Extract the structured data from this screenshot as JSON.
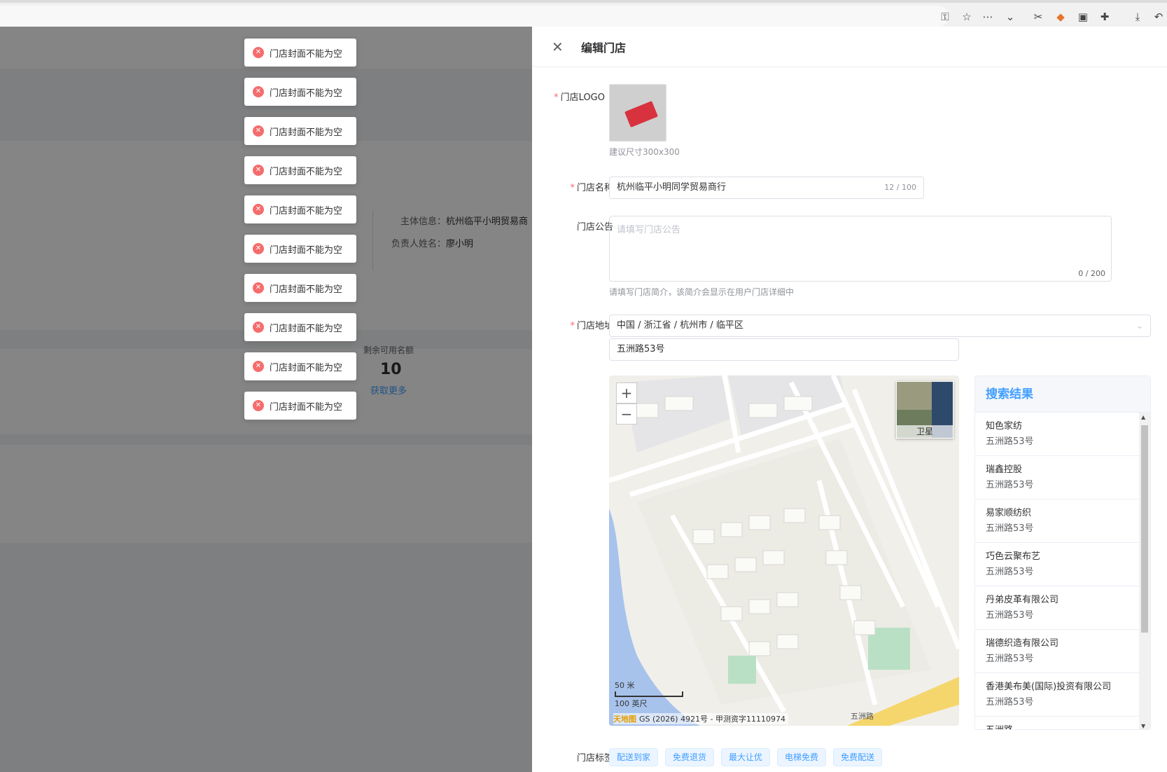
{
  "browser": {
    "icons": [
      "key-icon",
      "star-icon",
      "more-icon",
      "chevron-down-icon",
      "scissors-icon",
      "fox-extension-icon",
      "window-icon",
      "puzzle-icon",
      "download-icon",
      "undo-icon"
    ]
  },
  "background": {
    "subject_label": "主体信息：",
    "subject_value": "杭州临平小明贸易商",
    "owner_label": "负责人姓名：",
    "owner_value": "廖小明",
    "quota_label": "剩余可用名额",
    "quota_value": "10",
    "quota_link": "获取更多"
  },
  "toasts": [
    "门店封面不能为空",
    "门店封面不能为空",
    "门店封面不能为空",
    "门店封面不能为空",
    "门店封面不能为空",
    "门店封面不能为空",
    "门店封面不能为空",
    "门店封面不能为空",
    "门店封面不能为空",
    "门店封面不能为空"
  ],
  "drawer": {
    "close": "✕",
    "title": "编辑门店",
    "logo_label": "门店LOGO",
    "logo_hint": "建议尺寸300x300",
    "name_label": "门店名称",
    "name_value": "杭州临平小明同学贸易商行",
    "name_count": "12 / 100",
    "notice_label": "门店公告",
    "notice_placeholder": "请填写门店公告",
    "notice_count": "0 / 200",
    "notice_hint": "请填写门店简介，该简介会显示在用户门店详细中",
    "address_label": "门店地址",
    "region_value": "中国 / 浙江省 / 杭州市 / 临平区",
    "street_value": "五洲路53号",
    "tags_label": "门店标签",
    "tags": [
      "配送到家",
      "免费退货",
      "最大让优",
      "电梯免费",
      "免费配送"
    ]
  },
  "map": {
    "zoom_in": "+",
    "zoom_out": "−",
    "satellite_label": "卫星",
    "scale_m": "50 米",
    "scale_ft": "100 英尺",
    "brand": "天地图",
    "copyright": "GS (2026) 4921号 - 甲测资字11110974",
    "road_label": "五洲路"
  },
  "results": {
    "title": "搜索结果",
    "items": [
      {
        "name": "知色家纺",
        "addr": "五洲路53号"
      },
      {
        "name": "瑞鑫控股",
        "addr": "五洲路53号"
      },
      {
        "name": "易家顺纺织",
        "addr": "五洲路53号"
      },
      {
        "name": "巧色云聚布艺",
        "addr": "五洲路53号"
      },
      {
        "name": "丹弟皮革有限公司",
        "addr": "五洲路53号"
      },
      {
        "name": "瑞德织造有限公司",
        "addr": "五洲路53号"
      },
      {
        "name": "香港美布美(国际)投资有限公司",
        "addr": "五洲路53号"
      },
      {
        "name": "五洲路",
        "addr": ""
      }
    ]
  },
  "colors": {
    "primary": "#409eff",
    "danger": "#f56c6c"
  }
}
